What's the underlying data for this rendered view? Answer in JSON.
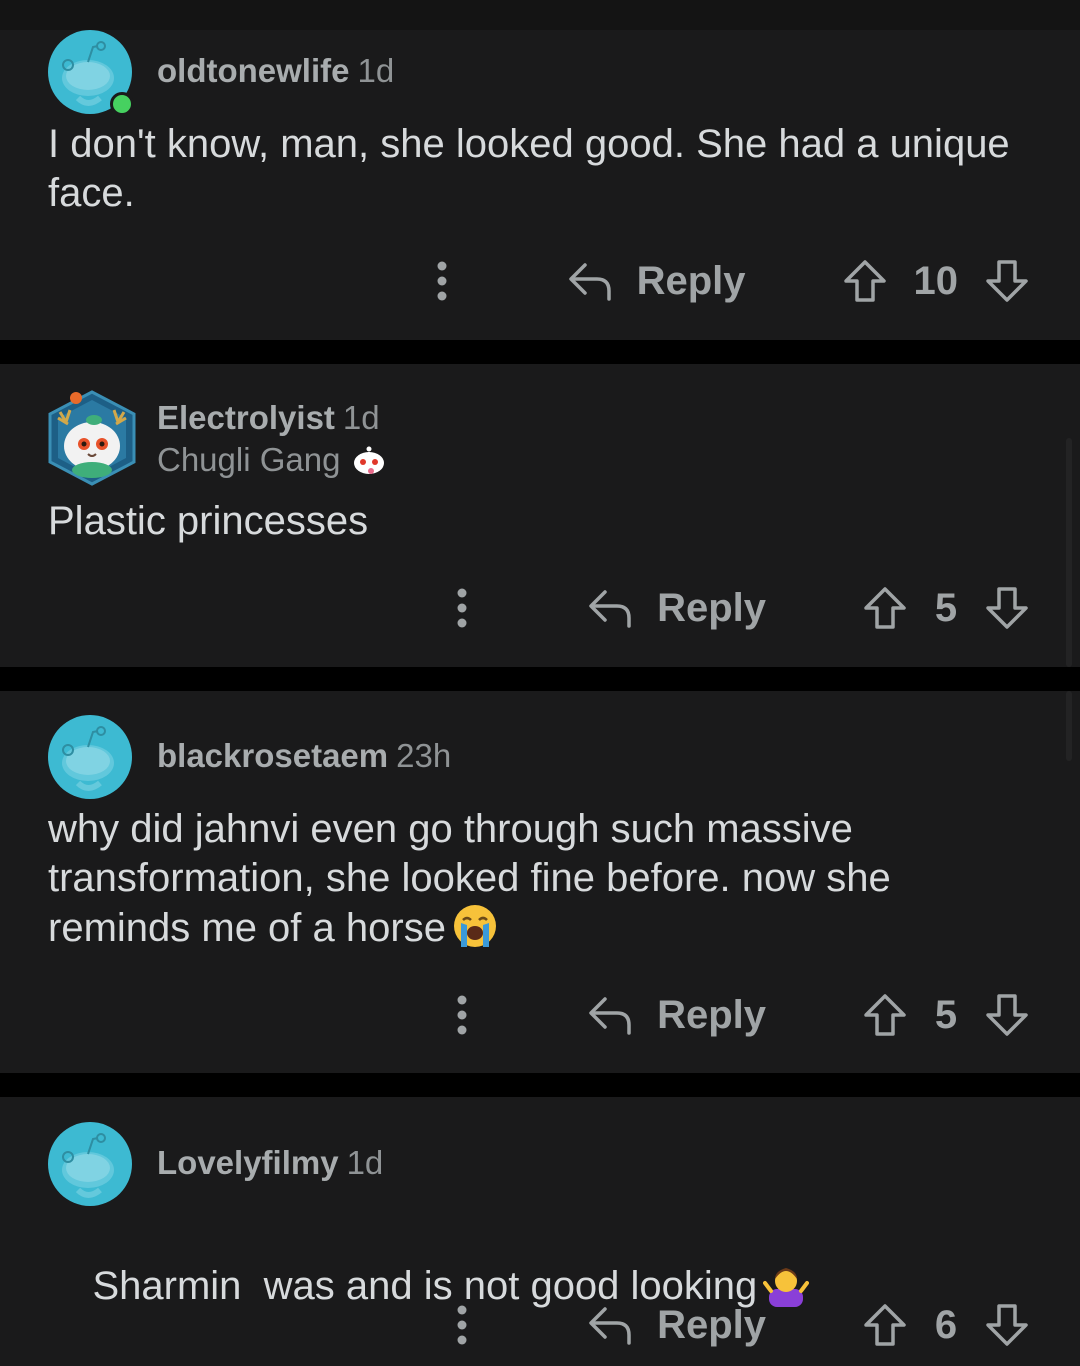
{
  "colors": {
    "background": "#000000",
    "card": "#1a1a1b",
    "text": "#d7dadc",
    "muted": "#a0a4a6",
    "avatar_teal": "#3dbad2",
    "online_green": "#46d160"
  },
  "actions": {
    "reply_label": "Reply",
    "more_icon": "more-vertical-icon",
    "reply_icon": "reply-arrow-icon",
    "upvote_icon": "upvote-arrow-icon",
    "downvote_icon": "downvote-arrow-icon"
  },
  "comments": [
    {
      "username": "oldtonewlife",
      "age": "1d",
      "avatar": "default-snoo-avatar",
      "online": true,
      "text": "I don't know, man, she looked good. She had a unique face.",
      "score": "10"
    },
    {
      "username": "Electrolyist",
      "age": "1d",
      "avatar": "custom-snoo-avatar",
      "flair": "Chugli Gang",
      "flair_icon": "snoo-face-icon",
      "text": "Plastic princesses",
      "score": "5"
    },
    {
      "username": "blackrosetaem",
      "age": "23h",
      "avatar": "default-snoo-avatar",
      "text": "why did jahnvi even go through such massive transformation, she looked fine before. now she reminds me of a horse",
      "emoji": "loudly-crying-face-emoji",
      "score": "5"
    },
    {
      "username": "Lovelyfilmy",
      "age": "1d",
      "avatar": "default-snoo-avatar",
      "text": "Sharmin  was and is not good looking",
      "emoji": "person-shrugging-emoji",
      "score": "6"
    }
  ]
}
